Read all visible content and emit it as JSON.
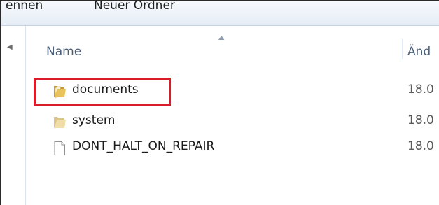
{
  "toolbar": {
    "rename_label": "ennen",
    "new_folder_label": "Neuer Ordner"
  },
  "columns": {
    "name": "Name",
    "date_modified": "Änd"
  },
  "files": [
    {
      "name": "documents",
      "date": "18.0",
      "icon": "folder-icon",
      "highlighted": true
    },
    {
      "name": "system",
      "date": "18.0",
      "icon": "folder-icon"
    },
    {
      "name": "DONT_HALT_ON_REPAIR",
      "date": "18.0",
      "icon": "file-icon"
    }
  ],
  "colors": {
    "highlight": "#d91b2a",
    "folder": "#e8c25a",
    "header_text": "#4c607a"
  }
}
